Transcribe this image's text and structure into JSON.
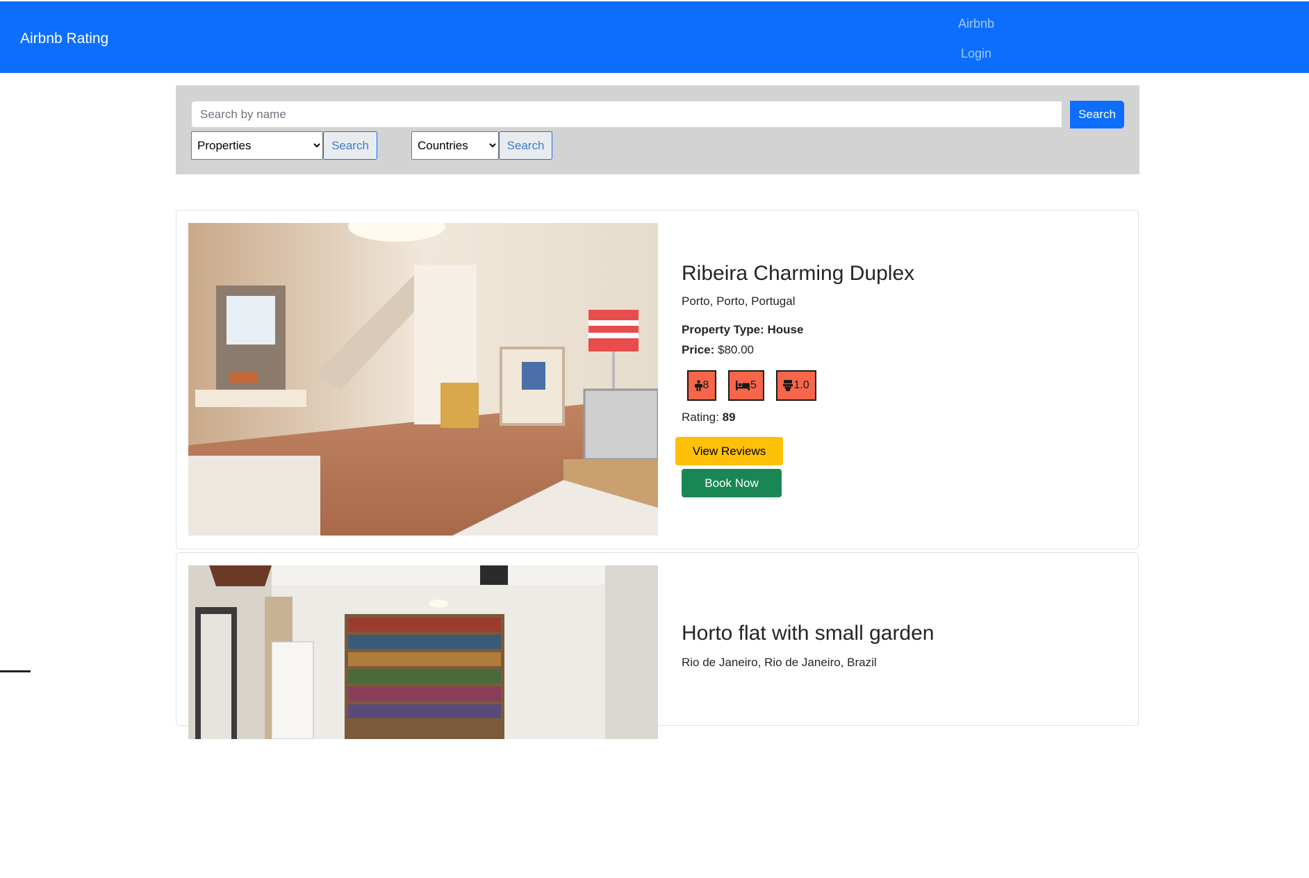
{
  "navbar": {
    "brand": "Airbnb Rating",
    "links": [
      "Airbnb",
      "Login"
    ],
    "color": "#0d6efd"
  },
  "search": {
    "placeholder": "Search by name",
    "button_label": "Search",
    "property_select": {
      "selected": "Properties"
    },
    "property_search_label": "Search",
    "country_select": {
      "selected": "Countries"
    },
    "country_search_label": "Search"
  },
  "listings": [
    {
      "title": "Ribeira Charming Duplex",
      "location": "Porto, Porto, Portugal",
      "property_type_label": "Property Type:",
      "property_type": "House",
      "price_label": "Price:",
      "price": "$80.00",
      "guests": "8",
      "beds": "5",
      "baths": "1.0",
      "rating_label": "Rating:",
      "rating": "89",
      "reviews_button": "View Reviews",
      "book_button": "Book Now"
    },
    {
      "title": "Horto flat with small garden",
      "location": "Rio de Janeiro, Rio de Janeiro, Brazil"
    }
  ],
  "colors": {
    "badge": "#f7654a",
    "reviews_button": "#ffc107",
    "book_button": "#198754",
    "search_panel": "#d3d3d3"
  },
  "icons": [
    "person-icon",
    "bed-icon",
    "toilet-icon"
  ]
}
